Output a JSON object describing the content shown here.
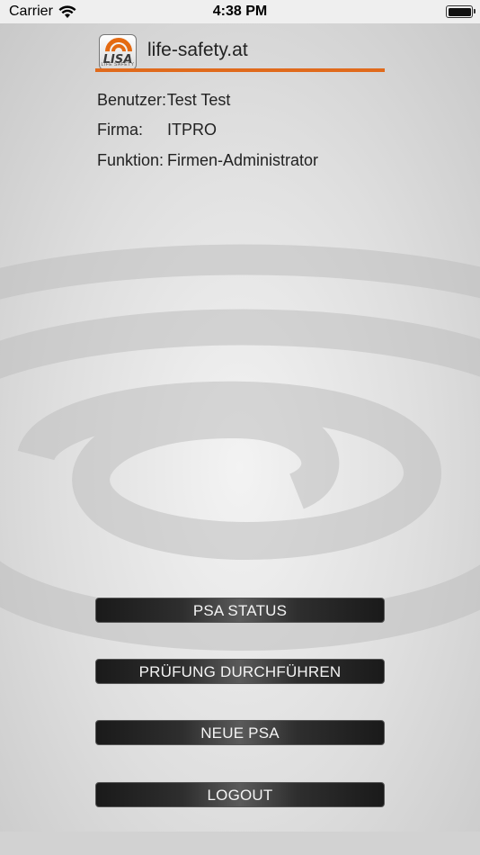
{
  "status_bar": {
    "carrier": "Carrier",
    "time": "4:38 PM",
    "wifi_icon": "wifi-icon",
    "battery_icon": "battery-full-icon"
  },
  "header": {
    "logo_text": "LISA",
    "logo_subtext": "LIFE SAFETY",
    "site_title": "life-safety.at",
    "accent_color": "#e06a1c"
  },
  "user_info": [
    {
      "label": "Benutzer:",
      "value": "Test Test"
    },
    {
      "label": "Firma:",
      "value": "ITPRO"
    },
    {
      "label": "Funktion:",
      "value": "Firmen-Administrator"
    }
  ],
  "buttons": {
    "psa_status": "PSA STATUS",
    "pruefung": "PRÜFUNG DURCHFÜHREN",
    "neue_psa": "NEUE PSA",
    "logout": "LOGOUT"
  }
}
